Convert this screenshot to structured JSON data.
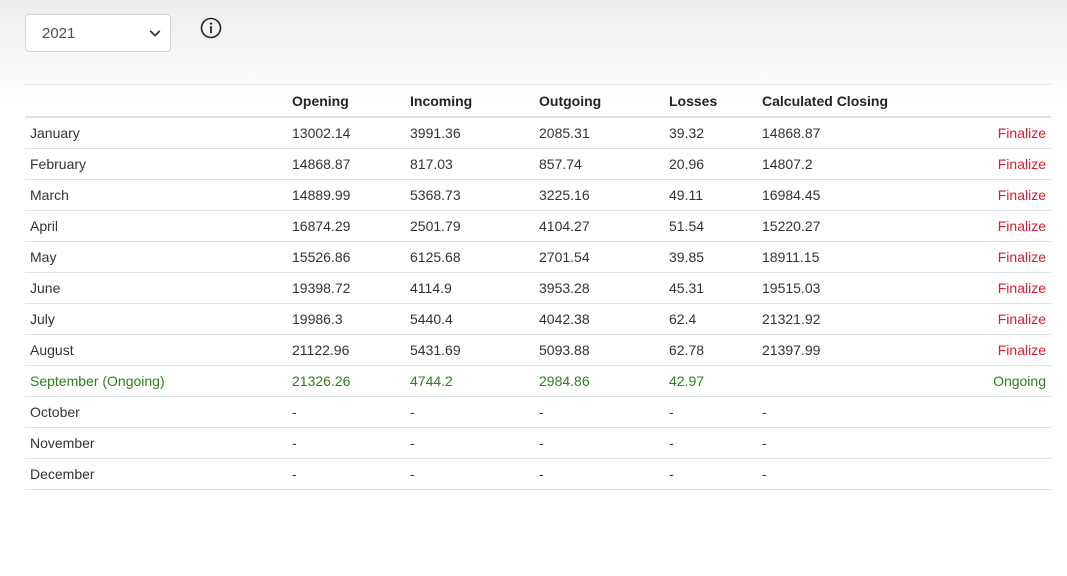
{
  "filter": {
    "year_selected": "2021"
  },
  "table": {
    "headers": {
      "month": "",
      "opening": "Opening",
      "incoming": "Incoming",
      "outgoing": "Outgoing",
      "losses": "Losses",
      "closing": "Calculated Closing",
      "action": ""
    },
    "rows": [
      {
        "month": "January",
        "opening": "13002.14",
        "incoming": "3991.36",
        "outgoing": "2085.31",
        "losses": "39.32",
        "closing": "14868.87",
        "action": "Finalize"
      },
      {
        "month": "February",
        "opening": "14868.87",
        "incoming": "817.03",
        "outgoing": "857.74",
        "losses": "20.96",
        "closing": "14807.2",
        "action": "Finalize"
      },
      {
        "month": "March",
        "opening": "14889.99",
        "incoming": "5368.73",
        "outgoing": "3225.16",
        "losses": "49.11",
        "closing": "16984.45",
        "action": "Finalize"
      },
      {
        "month": "April",
        "opening": "16874.29",
        "incoming": "2501.79",
        "outgoing": "4104.27",
        "losses": "51.54",
        "closing": "15220.27",
        "action": "Finalize"
      },
      {
        "month": "May",
        "opening": "15526.86",
        "incoming": "6125.68",
        "outgoing": "2701.54",
        "losses": "39.85",
        "closing": "18911.15",
        "action": "Finalize"
      },
      {
        "month": "June",
        "opening": "19398.72",
        "incoming": "4114.9",
        "outgoing": "3953.28",
        "losses": "45.31",
        "closing": "19515.03",
        "action": "Finalize"
      },
      {
        "month": "July",
        "opening": "19986.3",
        "incoming": "5440.4",
        "outgoing": "4042.38",
        "losses": "62.4",
        "closing": "21321.92",
        "action": "Finalize"
      },
      {
        "month": "August",
        "opening": "21122.96",
        "incoming": "5431.69",
        "outgoing": "5093.88",
        "losses": "62.78",
        "closing": "21397.99",
        "action": "Finalize"
      },
      {
        "month": "September (Ongoing)",
        "opening": "21326.26",
        "incoming": "4744.2",
        "outgoing": "2984.86",
        "losses": "42.97",
        "closing": "",
        "action": "Ongoing"
      },
      {
        "month": "October",
        "opening": "-",
        "incoming": "-",
        "outgoing": "-",
        "losses": "-",
        "closing": "-",
        "action": ""
      },
      {
        "month": "November",
        "opening": "-",
        "incoming": "-",
        "outgoing": "-",
        "losses": "-",
        "closing": "-",
        "action": ""
      },
      {
        "month": "December",
        "opening": "-",
        "incoming": "-",
        "outgoing": "-",
        "losses": "-",
        "closing": "-",
        "action": ""
      }
    ]
  },
  "colors": {
    "finalize": "#dc1a2e",
    "ongoing": "#2e7d1d"
  },
  "icons": {
    "year_dropdown": "chevron-down-icon",
    "info": "info-icon"
  }
}
